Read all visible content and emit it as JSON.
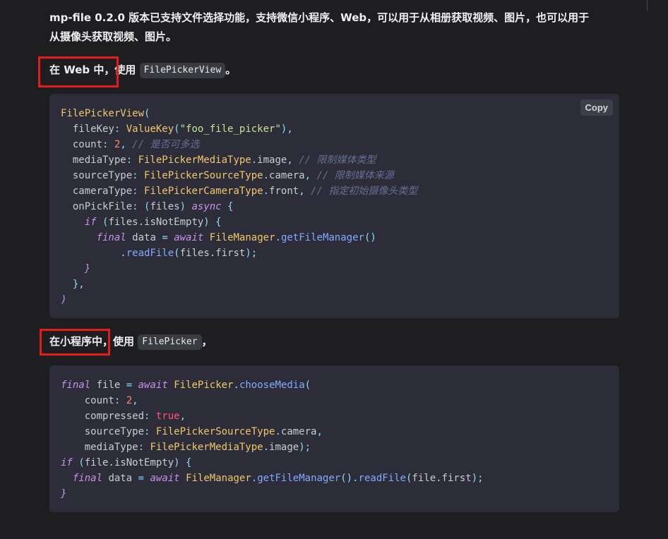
{
  "intro": {
    "line1": "mp-file 0.2.0 版本已支持文件选择功能，支持微信小程序、Web，可以用于从相册获取视频、图片，也可以用于",
    "line2": "从摄像头获取视频、图片。"
  },
  "web_section": {
    "heading_prefix": "在 Web 中，使用",
    "inline_code": "FilePickerView",
    "heading_suffix": "。"
  },
  "mini_section": {
    "heading_prefix": "在小程序中，使用",
    "inline_code": "FilePicker",
    "heading_suffix": "，"
  },
  "code_block_1": {
    "copy_label": "Copy",
    "tokens": {
      "l1_cls": "FilePickerView",
      "l2_prop": "fileKey",
      "l2_cls": "ValueKey",
      "l2_str": "\"foo_file_picker\"",
      "l3_prop": "count",
      "l3_num": "2",
      "l3_cmt": "// 是否可多选",
      "l4_prop": "mediaType",
      "l4_cls": "FilePickerMediaType",
      "l4_val": "image",
      "l4_cmt": "// 限制媒体类型",
      "l5_prop": "sourceType",
      "l5_cls": "FilePickerSourceType",
      "l5_val": "camera",
      "l5_cmt": "// 限制媒体来源",
      "l6_prop": "cameraType",
      "l6_cls": "FilePickerCameraType",
      "l6_val": "front",
      "l6_cmt": "// 指定初始摄像头类型",
      "l7_prop": "onPickFile",
      "l7_param": "files",
      "l7_kw": "async",
      "l8_kw": "if",
      "l8_expr": "files.isNotEmpty",
      "l9_kw1": "final",
      "l9_var": "data",
      "l9_kw2": "await",
      "l9_cls": "FileManager",
      "l9_fn": "getFileManager",
      "l10_fn": "readFile",
      "l10_arg": "files.first"
    }
  },
  "code_block_2": {
    "tokens": {
      "l1_kw1": "final",
      "l1_var": "file",
      "l1_kw2": "await",
      "l1_cls": "FilePicker",
      "l1_fn": "chooseMedia",
      "l2_prop": "count",
      "l2_num": "2",
      "l3_prop": "compressed",
      "l3_bool": "true",
      "l4_prop": "sourceType",
      "l4_cls": "FilePickerSourceType",
      "l4_val": "camera",
      "l5_prop": "mediaType",
      "l5_cls": "FilePickerMediaType",
      "l5_val": "image",
      "l6_kw": "if",
      "l6_expr": "file.isNotEmpty",
      "l7_kw1": "final",
      "l7_var": "data",
      "l7_kw2": "await",
      "l7_cls": "FileManager",
      "l7_fn1": "getFileManager",
      "l7_fn2": "readFile",
      "l7_arg": "file.first"
    }
  },
  "colors": {
    "background": "#1e1e21",
    "code_background": "#2c2d39",
    "highlight_box": "#e31c1c",
    "class_name": "#f1c86b",
    "string": "#c3e88d",
    "number": "#f78c6c",
    "comment": "#676e95",
    "keyword": "#c792ea",
    "function": "#82aaff"
  }
}
